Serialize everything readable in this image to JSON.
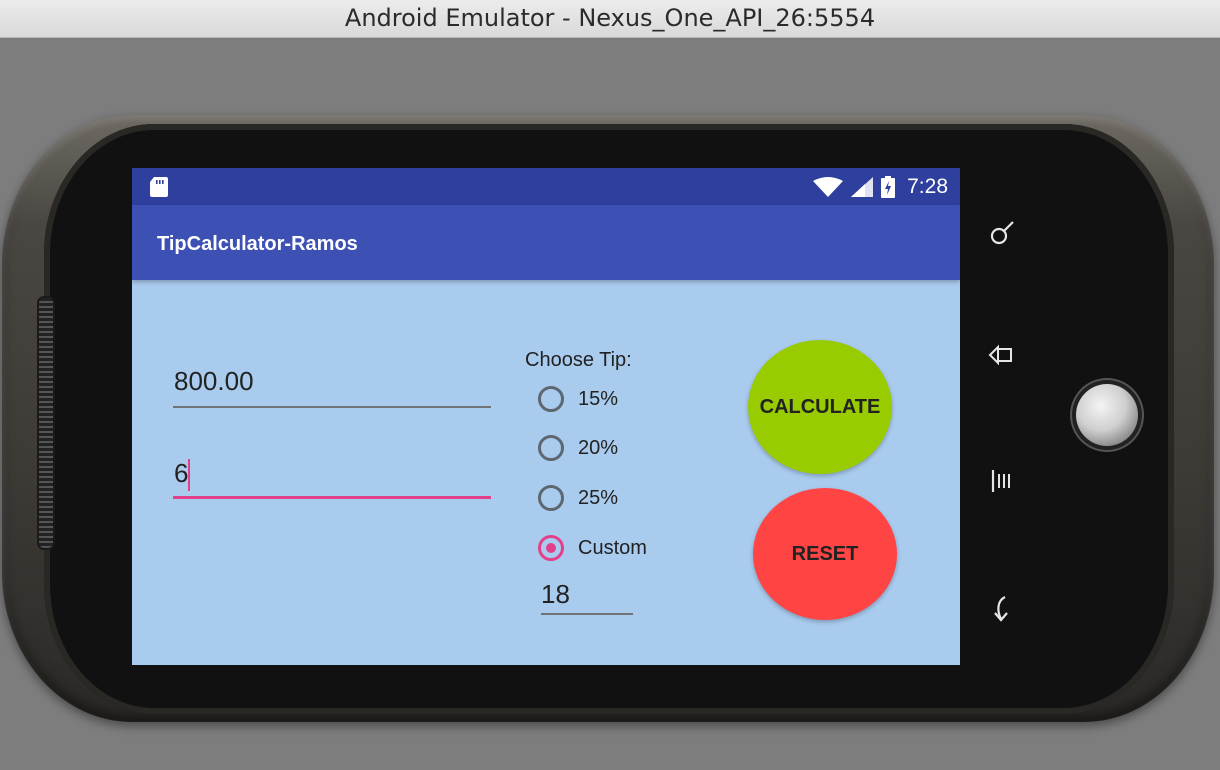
{
  "window": {
    "title": "Android Emulator - Nexus_One_API_26:5554"
  },
  "statusbar": {
    "time": "7:28"
  },
  "app": {
    "title": "TipCalculator-Ramos"
  },
  "form": {
    "bill_value": "800.00",
    "people_value": "6",
    "tip_label": "Choose Tip:",
    "tip_options": [
      {
        "label": "15%",
        "checked": false
      },
      {
        "label": "20%",
        "checked": false
      },
      {
        "label": "25%",
        "checked": false
      },
      {
        "label": "Custom",
        "checked": true
      }
    ],
    "custom_value": "18"
  },
  "buttons": {
    "calculate": "CALCULATE",
    "reset": "RESET"
  },
  "colors": {
    "statusbar": "#2f3f9e",
    "appbar": "#3d51b5",
    "background": "#a9cbee",
    "accent": "#e2408a",
    "calculate": "#99cc00",
    "reset": "#ff4444"
  }
}
